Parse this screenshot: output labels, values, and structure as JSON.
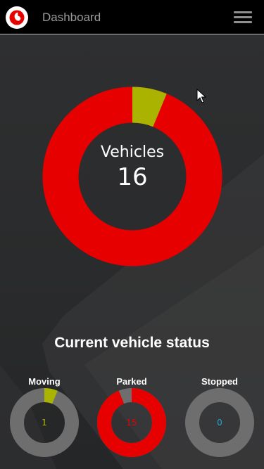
{
  "header": {
    "title": "Dashboard",
    "logo_icon": "vodafone-logo-icon",
    "menu_icon": "hamburger-menu-icon"
  },
  "overview": {
    "label": "Vehicles",
    "total": "16",
    "segments": [
      {
        "status": "moving",
        "count": 1,
        "color": "#a9b300"
      },
      {
        "status": "parked",
        "count": 15,
        "color": "#e60000"
      }
    ]
  },
  "status_section": {
    "title": "Current vehicle status",
    "cards": [
      {
        "label": "Moving",
        "value": "1",
        "fraction": 0.0625,
        "color": "#a9b300",
        "track_color": "#6e6e6e",
        "value_color": "#a9b300"
      },
      {
        "label": "Parked",
        "value": "15",
        "fraction": 0.9375,
        "color": "#e60000",
        "track_color": "#6e6e6e",
        "value_color": "#e60000"
      },
      {
        "label": "Stopped",
        "value": "0",
        "fraction": 0,
        "color": "#1ea7d4",
        "track_color": "#6e6e6e",
        "value_color": "#1ea7d4"
      }
    ]
  },
  "colors": {
    "header_bg": "#000000",
    "page_bg": "#2b2c2d",
    "brand_red": "#e60000",
    "moving": "#a9b300",
    "stopped": "#1ea7d4"
  }
}
